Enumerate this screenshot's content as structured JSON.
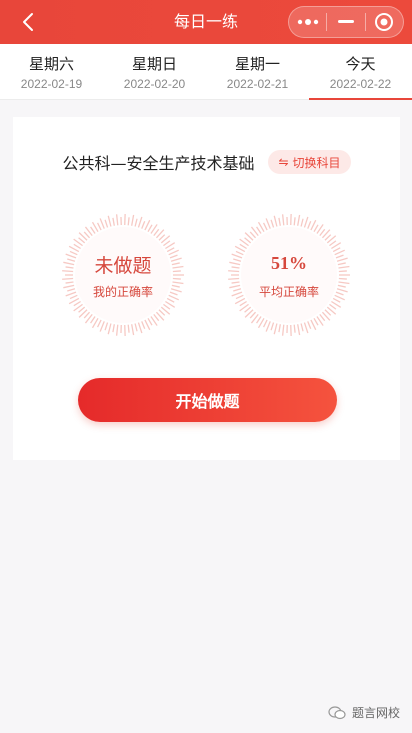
{
  "header": {
    "title": "每日一练",
    "icons": [
      "back-icon",
      "more-icon",
      "minimize-icon",
      "close-target-icon"
    ]
  },
  "date_tabs": [
    {
      "weekday": "星期六",
      "date": "2022-02-19",
      "active": false
    },
    {
      "weekday": "星期日",
      "date": "2022-02-20",
      "active": false
    },
    {
      "weekday": "星期一",
      "date": "2022-02-21",
      "active": false
    },
    {
      "weekday": "今天",
      "date": "2022-02-22",
      "active": true
    }
  ],
  "card": {
    "subject": "公共科—安全生产技术基础",
    "switch_label": "切换科目",
    "my_accuracy": {
      "value": "未做题",
      "label": "我的正确率"
    },
    "avg_accuracy": {
      "value": "51%",
      "label": "平均正确率"
    },
    "start_button": "开始做题"
  },
  "watermark": "题言网校",
  "colors": {
    "accent": "#e8463a",
    "ring": "#f6c9c4",
    "text_red": "#d6473c"
  }
}
